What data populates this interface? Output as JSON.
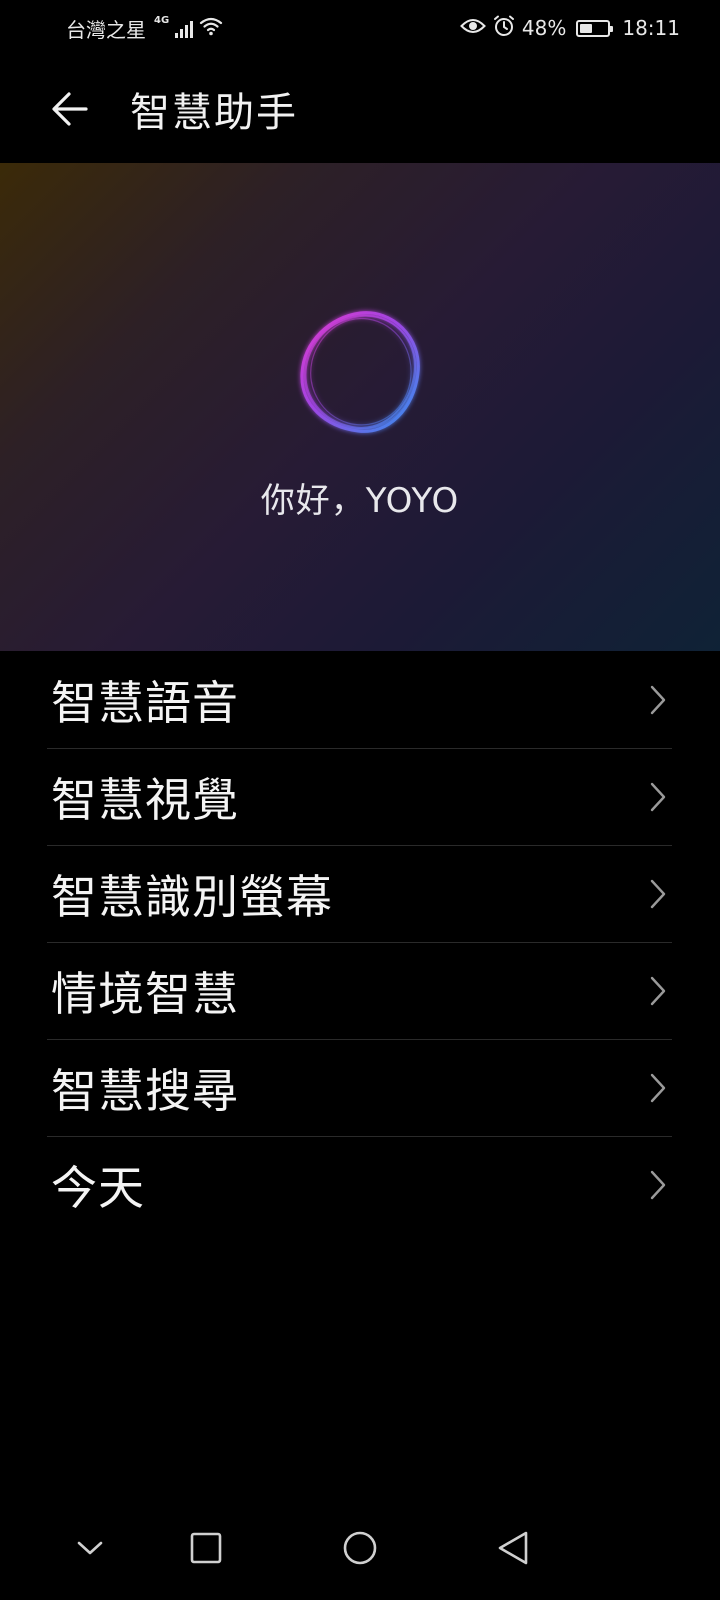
{
  "status_bar": {
    "carrier": "台灣之星",
    "network": "4G",
    "battery_percent": "48%",
    "battery_level": 0.48,
    "time": "18:11"
  },
  "header": {
    "title": "智慧助手"
  },
  "hero": {
    "greeting": "你好，YOYO"
  },
  "menu": {
    "items": [
      {
        "label": "智慧語音"
      },
      {
        "label": "智慧視覺"
      },
      {
        "label": "智慧識別螢幕"
      },
      {
        "label": "情境智慧"
      },
      {
        "label": "智慧搜尋"
      },
      {
        "label": "今天"
      }
    ]
  },
  "colors": {
    "background": "#000000",
    "text": "#f4f4f4",
    "chevron": "#9a9a9a",
    "divider": "#2a2a2a",
    "ring_magenta": "#d23cd6",
    "ring_blue": "#3b8cf0"
  },
  "icons": {
    "back": "back-arrow-icon",
    "chevron": "chevron-right-icon",
    "nav_collapse": "chevron-down-icon",
    "nav_recents": "square-icon",
    "nav_home": "circle-icon",
    "nav_back": "triangle-back-icon"
  }
}
